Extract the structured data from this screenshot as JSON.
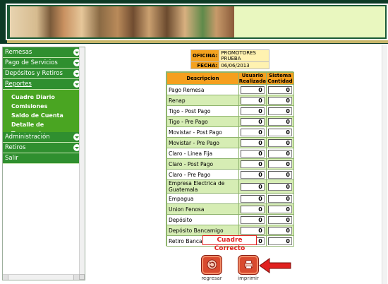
{
  "menu": {
    "items": [
      {
        "label": "Remesas",
        "expand": true
      },
      {
        "label": "Pago de Servicios",
        "expand": true
      },
      {
        "label": "Depósitos y Retiros",
        "expand": true
      }
    ],
    "active": {
      "label": "Reportes",
      "expand": true
    },
    "submenu": [
      "Cuadre Diario",
      "Comisiones",
      "Saldo de Cuenta",
      "Detalle de Transacciones"
    ],
    "after": [
      {
        "label": "Administración",
        "expand": true
      },
      {
        "label": "Retiros",
        "expand": true
      },
      {
        "label": "Salir",
        "expand": false
      }
    ]
  },
  "office": {
    "oficina_label": "OFICINA:",
    "oficina_value": "PROMOTORES PRUEBA",
    "fecha_label": "FECHA:",
    "fecha_value": "06/06/2013"
  },
  "table": {
    "col_desc": "Descripcion",
    "col_user_1": "Usuario",
    "col_user_2": "Realizada",
    "col_sys_1": "Sistema",
    "col_sys_2": "Cantidad",
    "rows": [
      {
        "desc": "Pago Remesa",
        "usuario": "0",
        "sistema": "0"
      },
      {
        "desc": "Renap",
        "usuario": "0",
        "sistema": "0"
      },
      {
        "desc": "Tigo - Post Pago",
        "usuario": "0",
        "sistema": "0"
      },
      {
        "desc": "Tigo - Pre Pago",
        "usuario": "0",
        "sistema": "0"
      },
      {
        "desc": "Movistar - Post Pago",
        "usuario": "0",
        "sistema": "0"
      },
      {
        "desc": "Movistar - Pre Pago",
        "usuario": "0",
        "sistema": "0"
      },
      {
        "desc": "Claro - Linea Fija",
        "usuario": "0",
        "sistema": "0"
      },
      {
        "desc": "Claro - Post Pago",
        "usuario": "0",
        "sistema": "0"
      },
      {
        "desc": "Claro - Pre Pago",
        "usuario": "0",
        "sistema": "0"
      },
      {
        "desc": "Empresa Electrica de Guatemala",
        "usuario": "0",
        "sistema": "0"
      },
      {
        "desc": "Empagua",
        "usuario": "0",
        "sistema": "0"
      },
      {
        "desc": "Union Fenosa",
        "usuario": "0",
        "sistema": "0"
      },
      {
        "desc": "Depósito",
        "usuario": "0",
        "sistema": "0"
      },
      {
        "desc": "Depósito Bancamigo",
        "usuario": "0",
        "sistema": "0"
      },
      {
        "desc": "Retiro Bancamigo",
        "usuario": "0",
        "sistema": "0"
      }
    ]
  },
  "status": "Cuadre Correcto",
  "buttons": {
    "regresar": "regresar",
    "imprimir": "imprimir"
  },
  "colors": {
    "accent": "#2f8f2f",
    "header": "#f59f1e",
    "alert": "#e0211f"
  }
}
